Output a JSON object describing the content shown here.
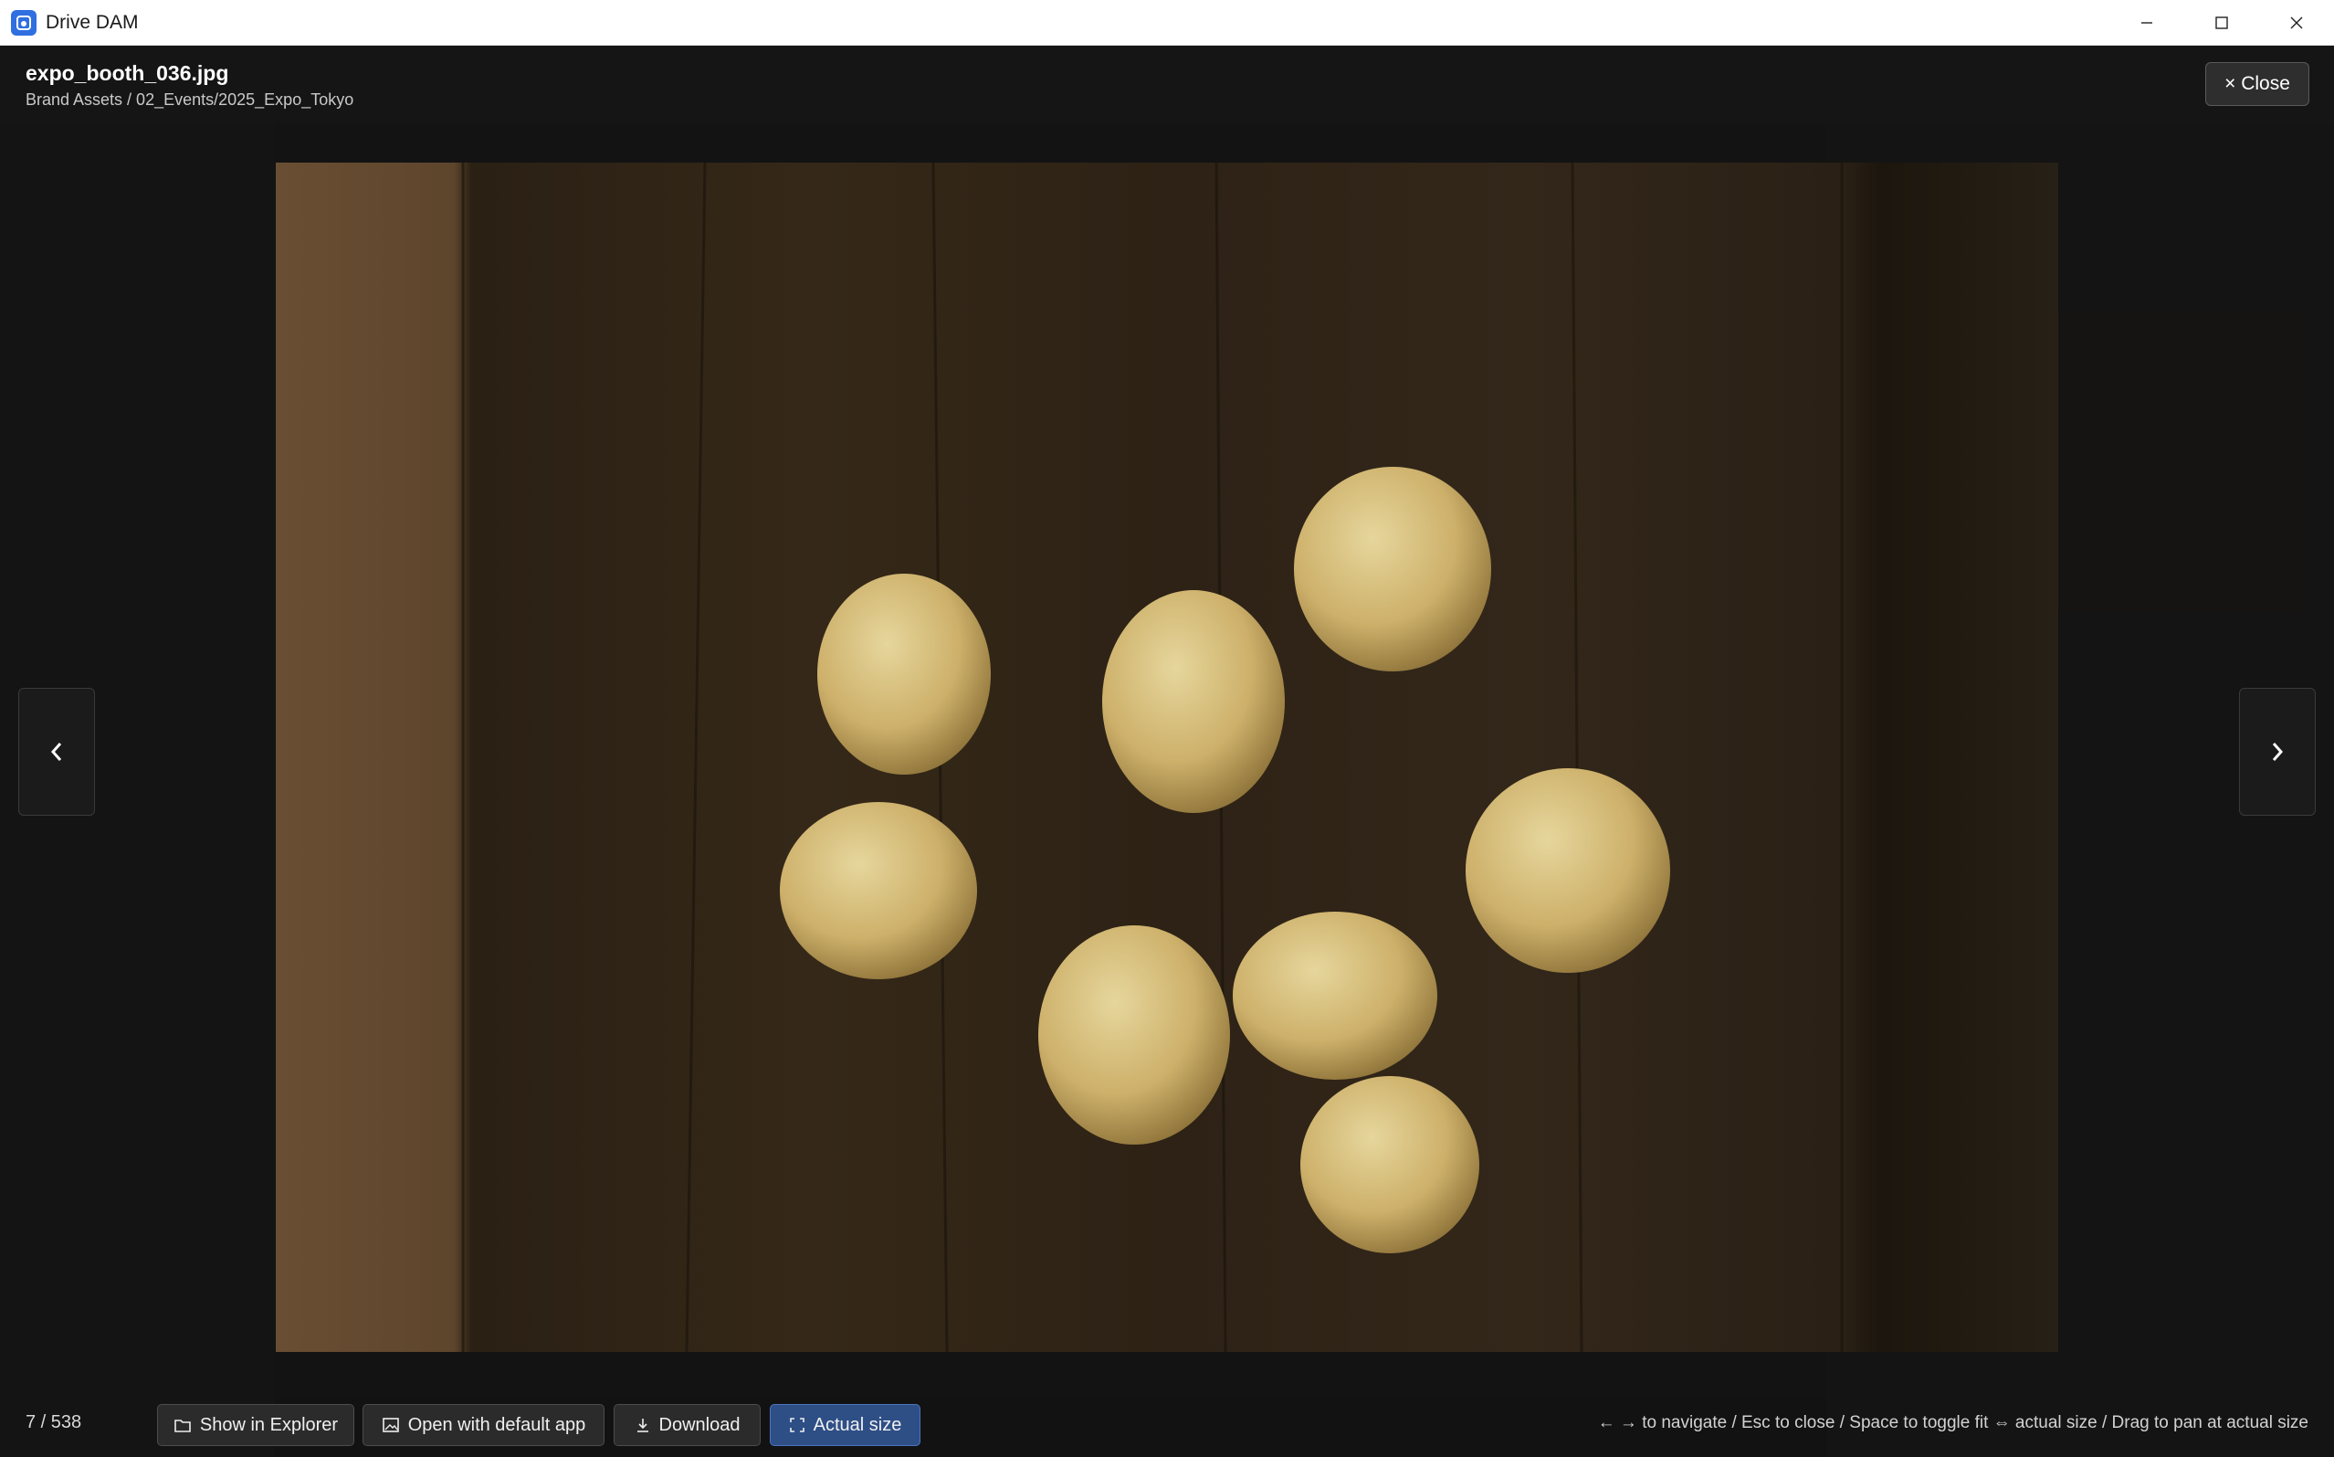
{
  "window": {
    "title": "Drive DAM"
  },
  "viewer": {
    "file_name": "expo_booth_036.jpg",
    "path": "Brand Assets / 02_Events/2025_Expo_Tokyo",
    "close_label": "× Close",
    "counter": "7 / 538",
    "hint": "← → to navigate / Esc to close / Space to toggle fit ⇔ actual size / Drag to pan at actual size",
    "actions": [
      {
        "label": "Show in Explorer",
        "icon": "folder-icon"
      },
      {
        "label": "Open with default app",
        "icon": "image-icon"
      },
      {
        "label": "Download",
        "icon": "download-icon"
      },
      {
        "label": "Actual size",
        "icon": "expand-icon",
        "active": true
      }
    ]
  },
  "colors": {
    "accent": "#2e4e86",
    "app_icon": "#2f6fe0",
    "overlay": "#101010"
  },
  "icons": [
    "minimize-icon",
    "maximize-icon",
    "close-icon",
    "chevron-left-icon",
    "chevron-right-icon"
  ]
}
